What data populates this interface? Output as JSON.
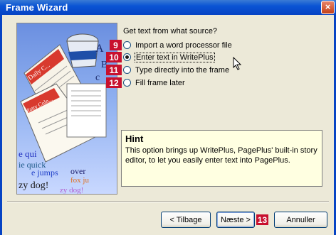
{
  "window": {
    "title": "Frame Wizard",
    "close_glyph": "×"
  },
  "prompt": "Get text from what source?",
  "options": [
    {
      "label": "Import a word processor file",
      "selected": false
    },
    {
      "label": "Enter text in WritePlus",
      "selected": true
    },
    {
      "label": "Type directly into the frame",
      "selected": false
    },
    {
      "label": "Fill frame later",
      "selected": false
    }
  ],
  "badges": [
    "9",
    "10",
    "11",
    "12",
    "13"
  ],
  "hint": {
    "title": "Hint",
    "text": "This option brings up WritePlus, PagePlus' built-in story editor, to let you easily enter text into PagePlus."
  },
  "buttons": {
    "back": "< Tilbage",
    "next": "Næste >",
    "cancel": "Annuller"
  },
  "illustration": {
    "headline1": "Daily C...",
    "headline2": "Matty Coln...",
    "words": [
      "e qui",
      "ie quick",
      "e jumps",
      "zy dog!",
      "over",
      "fox ju",
      "zy dog!",
      "A",
      "B",
      "c"
    ]
  },
  "colors": {
    "titlebar": "#0a54d4",
    "badge": "#c8102e",
    "hint_bg": "#ffffe1"
  }
}
